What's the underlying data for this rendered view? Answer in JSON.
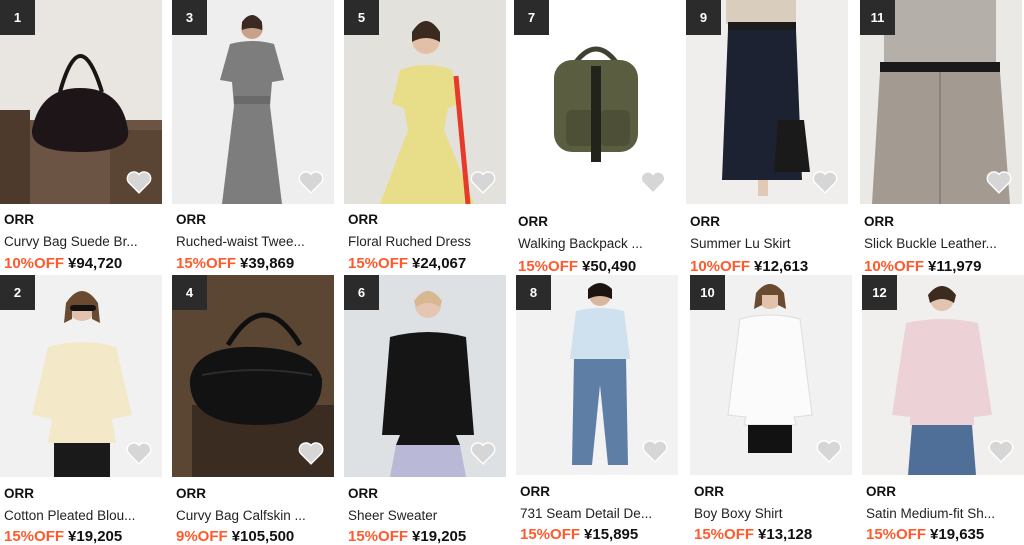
{
  "products": [
    {
      "rank": "1",
      "brand": "ORR",
      "title": "Curvy Bag Suede Br...",
      "discount": "10%OFF",
      "price": "¥94,720"
    },
    {
      "rank": "3",
      "brand": "ORR",
      "title": "Ruched-waist Twee...",
      "discount": "15%OFF",
      "price": "¥39,869"
    },
    {
      "rank": "5",
      "brand": "ORR",
      "title": "Floral Ruched Dress",
      "discount": "15%OFF",
      "price": "¥24,067"
    },
    {
      "rank": "7",
      "brand": "ORR",
      "title": "Walking Backpack ...",
      "discount": "15%OFF",
      "price": "¥50,490"
    },
    {
      "rank": "9",
      "brand": "ORR",
      "title": "Summer Lu Skirt",
      "discount": "10%OFF",
      "price": "¥12,613"
    },
    {
      "rank": "11",
      "brand": "ORR",
      "title": "Slick Buckle Leather...",
      "discount": "10%OFF",
      "price": "¥11,979"
    },
    {
      "rank": "2",
      "brand": "ORR",
      "title": "Cotton Pleated Blou...",
      "discount": "15%OFF",
      "price": "¥19,205"
    },
    {
      "rank": "4",
      "brand": "ORR",
      "title": "Curvy Bag Calfskin ...",
      "discount": "9%OFF",
      "price": "¥105,500"
    },
    {
      "rank": "6",
      "brand": "ORR",
      "title": "Sheer Sweater",
      "discount": "15%OFF",
      "price": "¥19,205"
    },
    {
      "rank": "8",
      "brand": "ORR",
      "title": "731 Seam Detail De...",
      "discount": "15%OFF",
      "price": "¥15,895"
    },
    {
      "rank": "10",
      "brand": "ORR",
      "title": "Boy Boxy Shirt",
      "discount": "15%OFF",
      "price": "¥13,128"
    },
    {
      "rank": "12",
      "brand": "ORR",
      "title": "Satin Medium-fit Sh...",
      "discount": "15%OFF",
      "price": "¥19,635"
    }
  ],
  "icons": {
    "favorite": "heart-icon"
  },
  "colors": {
    "discount": "#ff5a2c",
    "rank_badge": "#2b2b2b",
    "heart": "#cfcfcf"
  }
}
